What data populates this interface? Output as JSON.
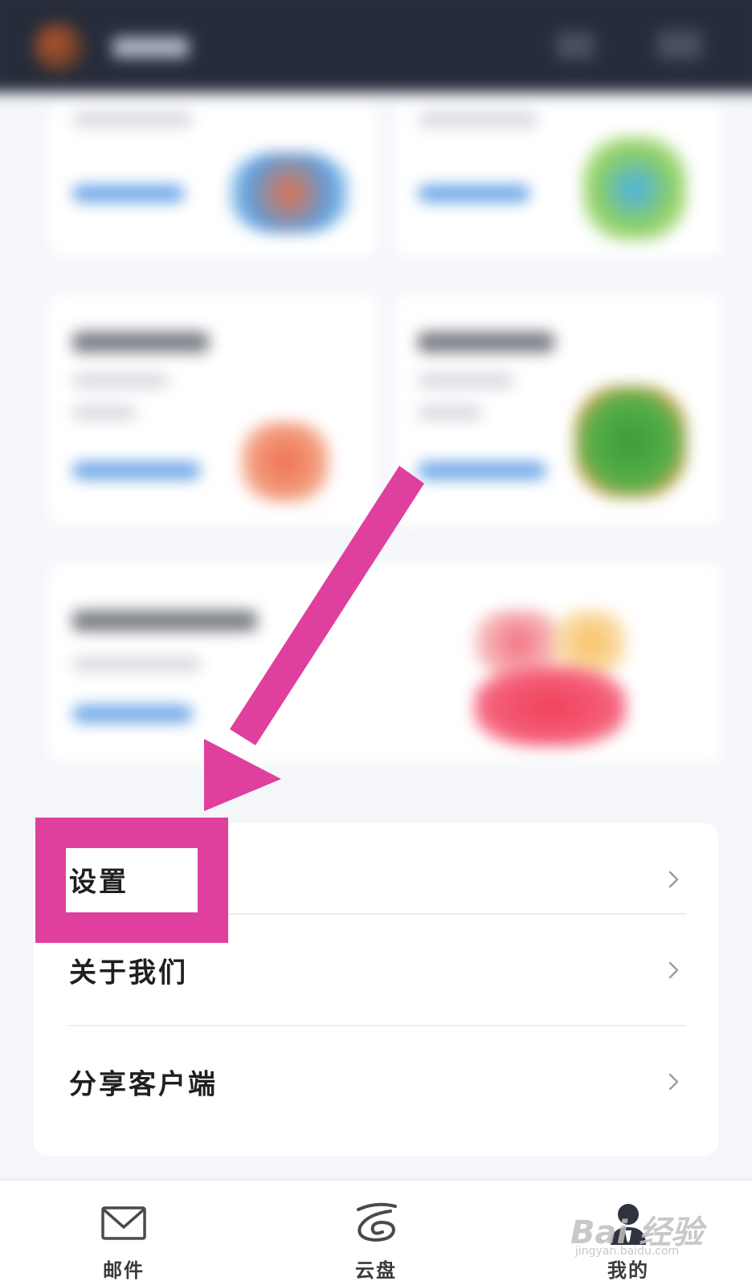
{
  "menu": {
    "items": [
      {
        "label": "设置"
      },
      {
        "label": "关于我们"
      },
      {
        "label": "分享客户端"
      }
    ]
  },
  "tabbar": {
    "tabs": [
      {
        "label": "邮件",
        "icon": "mail-icon"
      },
      {
        "label": "云盘",
        "icon": "cloud-disk-icon"
      },
      {
        "label": "我的",
        "icon": "person-icon",
        "active": true
      }
    ]
  },
  "watermark": {
    "brand": "Bai 经验",
    "url": "jingyan.baidu.com"
  },
  "colors": {
    "header_bg": "#262c3a",
    "page_bg": "#f4f6fa",
    "annotation_magenta": "#df3f9d",
    "link_blue": "#6fa8e8"
  }
}
